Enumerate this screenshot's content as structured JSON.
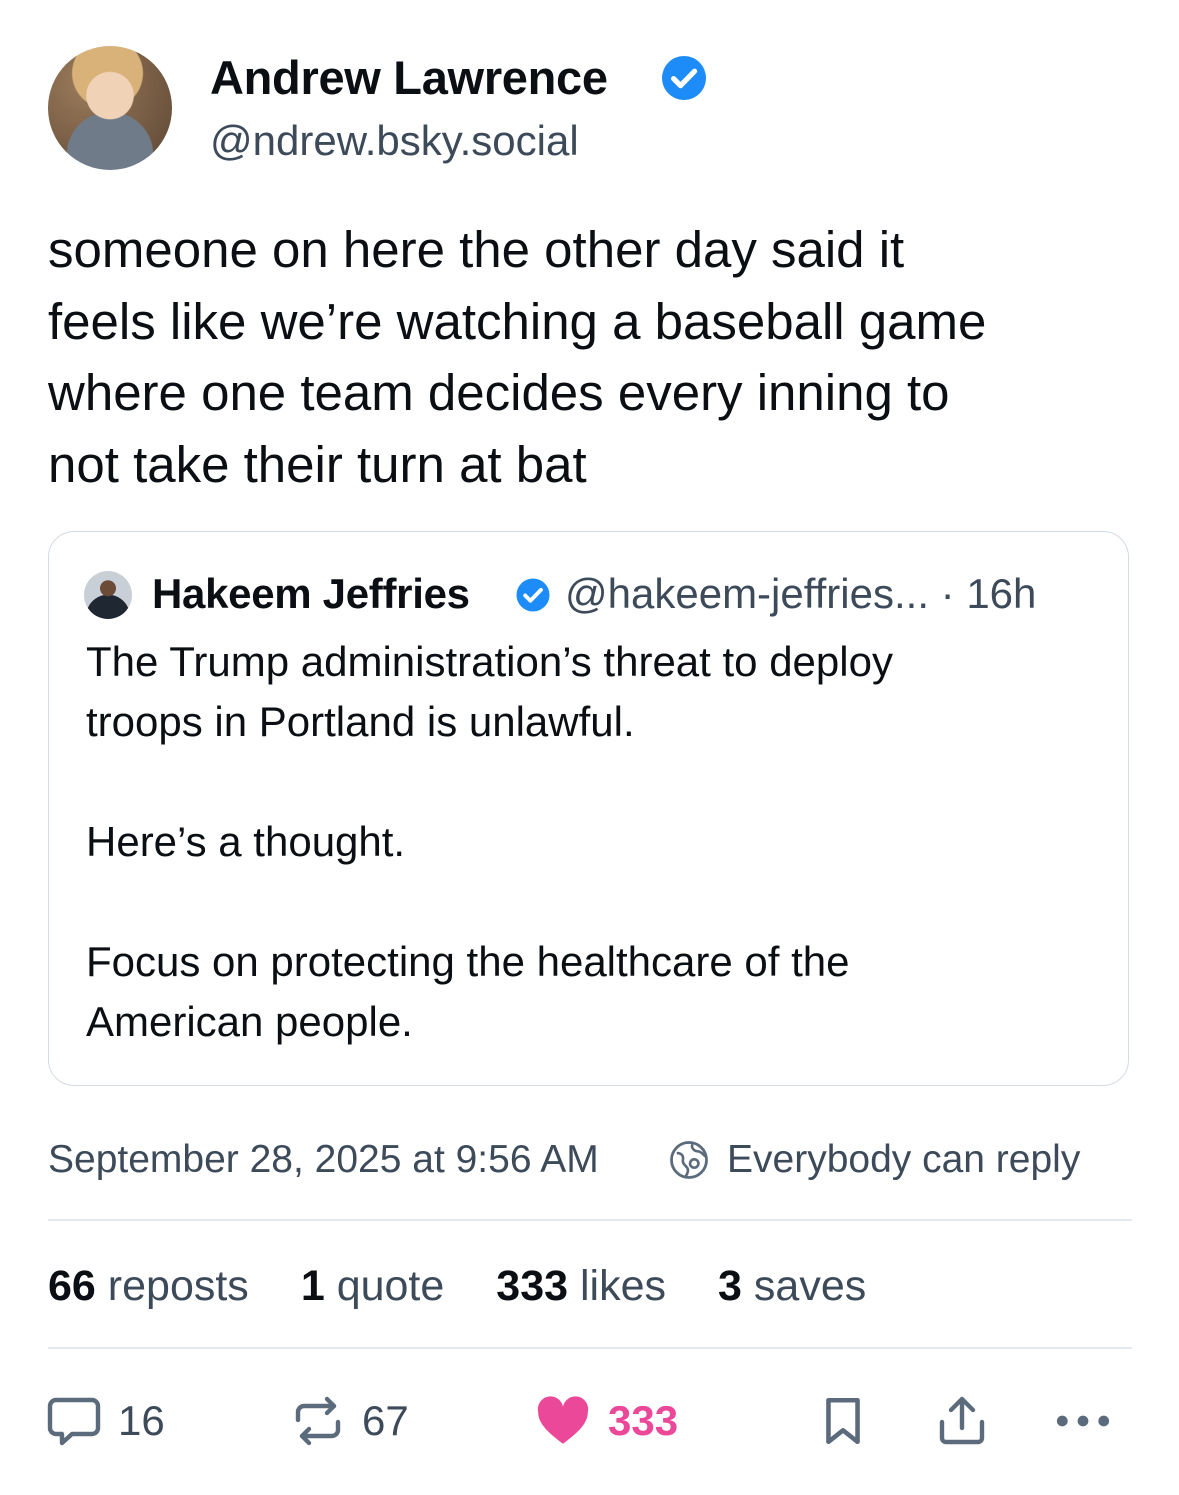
{
  "author": {
    "name": "Andrew Lawrence",
    "handle": "@ndrew.bsky.social"
  },
  "post": {
    "lines": [
      "someone on here the other day said it",
      "feels like we’re watching a baseball game",
      "where one team decides every inning to",
      "not take their turn at bat"
    ]
  },
  "quote": {
    "name": "Hakeem Jeffries",
    "meta": "@hakeem-jeffries... · 16h",
    "lines": [
      "The Trump administration’s threat to deploy",
      "troops in Portland is unlawful.",
      "",
      "Here’s a thought.",
      "",
      "Focus on protecting the healthcare of the",
      "American people."
    ]
  },
  "meta": {
    "timestamp": "September 28, 2025 at 9:56 AM",
    "reply_setting": "Everybody can reply"
  },
  "stats": [
    {
      "count": "66",
      "label": "reposts"
    },
    {
      "count": "1",
      "label": "quote"
    },
    {
      "count": "333",
      "label": "likes"
    },
    {
      "count": "3",
      "label": "saves"
    }
  ],
  "actions": {
    "reply_count": "16",
    "repost_count": "67",
    "like_count": "333"
  },
  "colors": {
    "verified": "#1d8cf8",
    "like": "#ec4899",
    "muted_text": "#3c4a59",
    "border": "#d4dbe2"
  },
  "icons": [
    "verified-badge-icon",
    "globe-icon",
    "comment-icon",
    "repost-icon",
    "heart-icon",
    "bookmark-icon",
    "share-icon",
    "more-icon"
  ]
}
